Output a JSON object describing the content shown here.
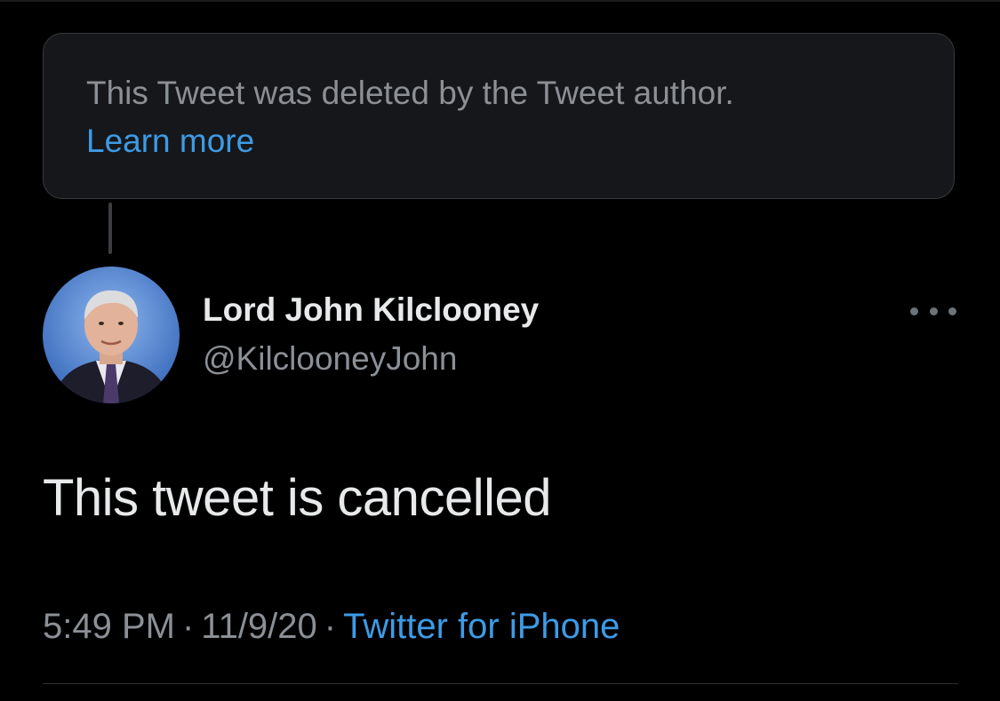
{
  "deleted_notice": {
    "text": "This Tweet was deleted by the Tweet author.",
    "link_label": "Learn more"
  },
  "tweet": {
    "display_name": "Lord John Kilclooney",
    "handle": "@KilclooneyJohn",
    "text": "This tweet is cancelled",
    "time": "5:49 PM",
    "separator": "·",
    "date": "11/9/20",
    "source": "Twitter for iPhone",
    "more_icon": "ellipsis-icon"
  },
  "colors": {
    "background": "#000000",
    "card": "#16171a",
    "link": "#3d9be6",
    "secondary_text": "#8b9096",
    "primary_text": "#e7e9ea"
  }
}
